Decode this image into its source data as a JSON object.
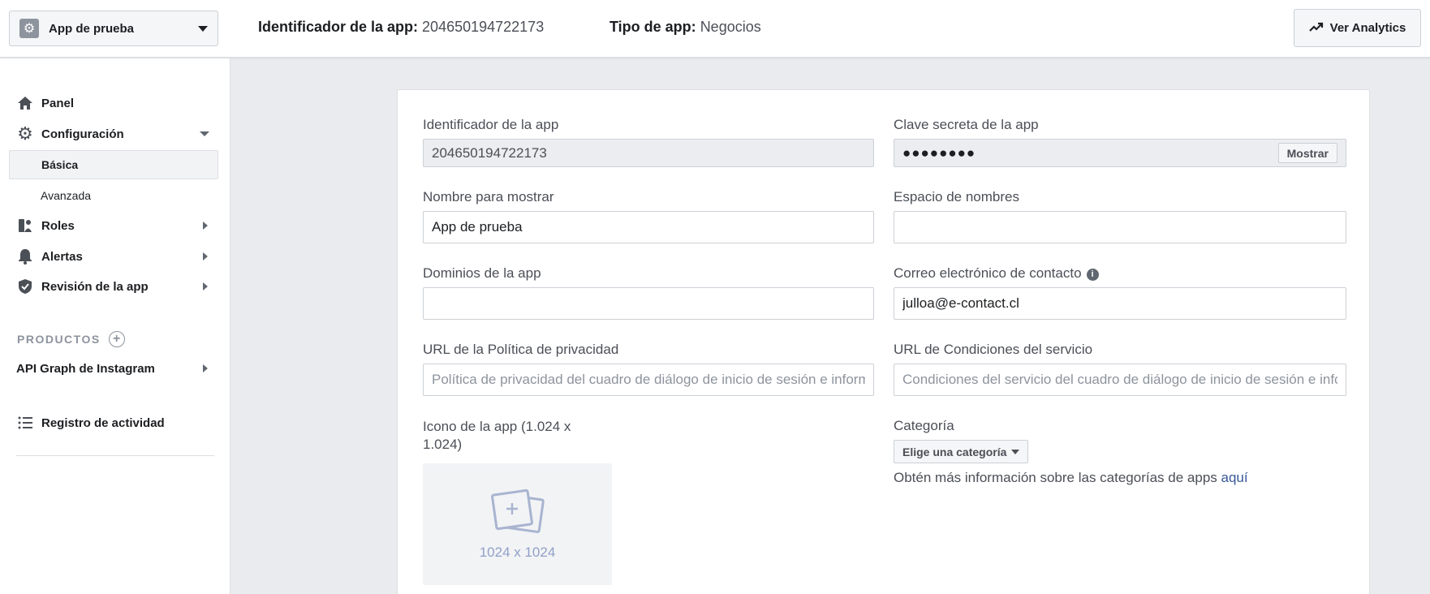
{
  "topbar": {
    "app_name": "App de prueba",
    "app_id_label": "Identificador de la app:",
    "app_id_value": "204650194722173",
    "app_type_label": "Tipo de app:",
    "app_type_value": "Negocios",
    "analytics_label": "Ver Analytics"
  },
  "sidebar": {
    "panel": "Panel",
    "configuracion": "Configuración",
    "basica": "Básica",
    "avanzada": "Avanzada",
    "roles": "Roles",
    "alertas": "Alertas",
    "revision": "Revisión de la app",
    "products_header": "PRODUCTOS",
    "instagram": "API Graph de Instagram",
    "registro": "Registro de actividad"
  },
  "form": {
    "app_id_label": "Identificador de la app",
    "app_id_value": "204650194722173",
    "secret_label": "Clave secreta de la app",
    "secret_value": "●●●●●●●●",
    "show_label": "Mostrar",
    "display_name_label": "Nombre para mostrar",
    "display_name_value": "App de prueba",
    "namespace_label": "Espacio de nombres",
    "namespace_value": "",
    "domains_label": "Dominios de la app",
    "domains_value": "",
    "contact_email_label": "Correo electrónico de contacto",
    "contact_email_value": "julloa@e-contact.cl",
    "privacy_label": "URL de la Política de privacidad",
    "privacy_placeholder": "Política de privacidad del cuadro de diálogo de inicio de sesión e información",
    "terms_label": "URL de Condiciones del servicio",
    "terms_placeholder": "Condiciones del servicio del cuadro de diálogo de inicio de sesión e información",
    "icon_label": "Icono de la app (1.024 x 1.024)",
    "icon_size": "1024 x 1024",
    "category_label": "Categoría",
    "category_button": "Elige una categoría",
    "category_info": "Obtén más información sobre las categorías de apps",
    "category_link": "aquí"
  }
}
